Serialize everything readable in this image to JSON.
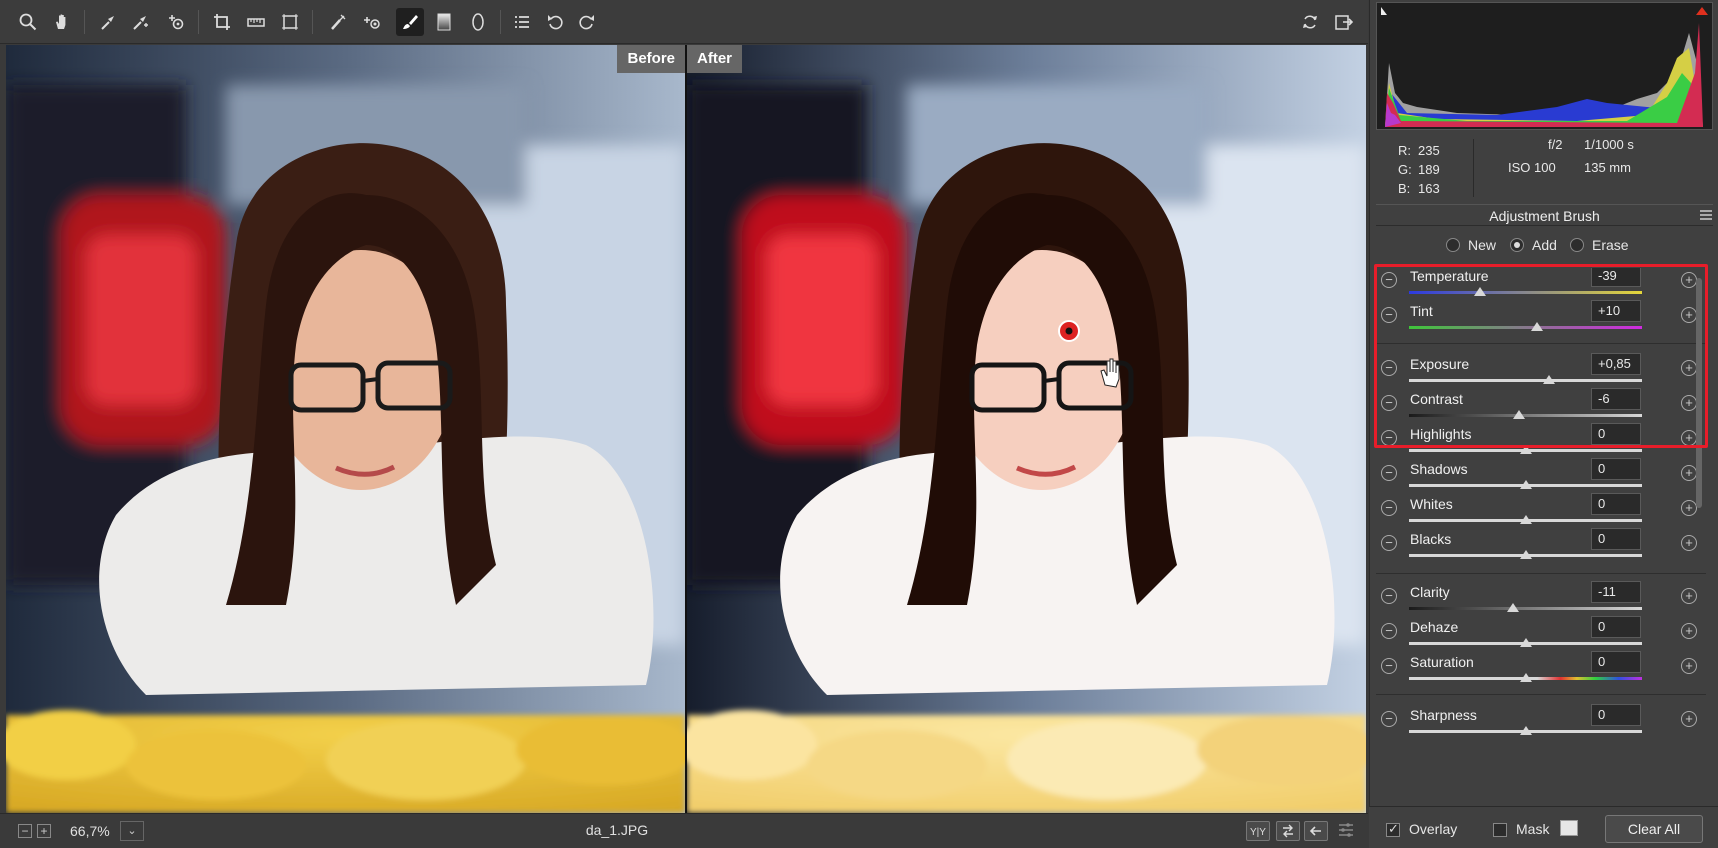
{
  "toolbar": {
    "tools": [
      "zoom-icon",
      "hand-icon",
      "white-balance-icon",
      "color-sampler-icon",
      "targeted-adjustment-icon",
      "crop-icon",
      "straighten-icon",
      "transform-icon",
      "spot-removal-icon",
      "red-eye-icon",
      "adjustment-brush-icon",
      "graduated-filter-icon",
      "radial-filter-icon",
      "preferences-icon",
      "rotate-left-icon",
      "rotate-right-icon",
      "refresh-icon",
      "open-image-icon"
    ],
    "active_tool": "adjustment-brush-icon"
  },
  "preview": {
    "before_label": "Before",
    "after_label": "After"
  },
  "statusbar": {
    "zoom": "66,7%",
    "zoom_minus": "−",
    "zoom_plus": "+",
    "zoom_dropdown": "⌄",
    "filename": "da_1.JPG"
  },
  "info": {
    "r_label": "R:",
    "r": "235",
    "g_label": "G:",
    "g": "189",
    "b_label": "B:",
    "b": "163",
    "aperture": "f/2",
    "shutter": "1/1000 s",
    "iso": "ISO 100",
    "focal": "135 mm"
  },
  "panel": {
    "title": "Adjustment Brush",
    "modes": [
      {
        "label": "New",
        "selected": false
      },
      {
        "label": "Add",
        "selected": true
      },
      {
        "label": "Erase",
        "selected": false
      }
    ]
  },
  "sliders": [
    {
      "label": "Temperature",
      "value": "-39",
      "fraction": 0.305
    },
    {
      "label": "Tint",
      "value": "+10",
      "fraction": 0.55
    },
    {
      "label": "Exposure",
      "value": "+0,85",
      "fraction": 0.6
    },
    {
      "label": "Contrast",
      "value": "-6",
      "fraction": 0.47
    },
    {
      "label": "Highlights",
      "value": "0",
      "fraction": 0.5
    },
    {
      "label": "Shadows",
      "value": "0",
      "fraction": 0.5
    },
    {
      "label": "Whites",
      "value": "0",
      "fraction": 0.5
    },
    {
      "label": "Blacks",
      "value": "0",
      "fraction": 0.5
    },
    {
      "label": "Clarity",
      "value": "-11",
      "fraction": 0.445
    },
    {
      "label": "Dehaze",
      "value": "0",
      "fraction": 0.5
    },
    {
      "label": "Saturation",
      "value": "0",
      "fraction": 0.5
    },
    {
      "label": "Sharpness",
      "value": "0",
      "fraction": 0.5
    }
  ],
  "footer": {
    "overlay_label": "Overlay",
    "overlay_checked": true,
    "mask_label": "Mask",
    "mask_checked": false,
    "clear_all_label": "Clear All"
  },
  "colors": {
    "highlight": "#e81d2a",
    "panel_bg": "#404040",
    "toolbar_bg": "#3c3c3c"
  }
}
